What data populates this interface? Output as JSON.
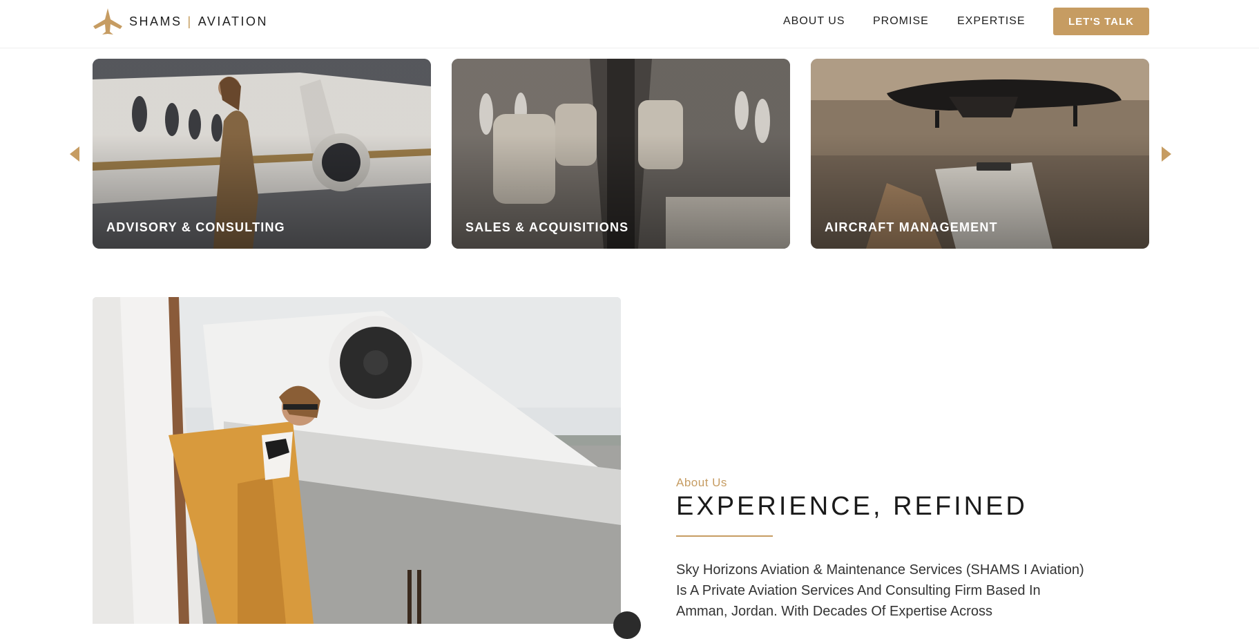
{
  "header": {
    "brand_left": "SHAMS",
    "brand_separator": "|",
    "brand_right": "AVIATION",
    "nav": [
      "ABOUT US",
      "PROMISE",
      "EXPERTISE"
    ],
    "cta_label": "LET'S TALK"
  },
  "services": [
    {
      "title": "ADVISORY & CONSULTING"
    },
    {
      "title": "SALES & ACQUISITIONS"
    },
    {
      "title": "AIRCRAFT MANAGEMENT"
    }
  ],
  "about": {
    "eyebrow": "About Us",
    "title": "EXPERIENCE, REFINED",
    "body": "Sky Horizons Aviation & Maintenance Services (SHAMS I Aviation) Is A Private Aviation Services And Consulting Firm Based In Amman, Jordan. With Decades Of Expertise Across"
  },
  "colors": {
    "accent": "#c69c62",
    "text": "#1f1f1f"
  },
  "icons": {
    "logo": "plane-logo-icon",
    "prev": "triangle-left-icon",
    "next": "triangle-right-icon"
  }
}
